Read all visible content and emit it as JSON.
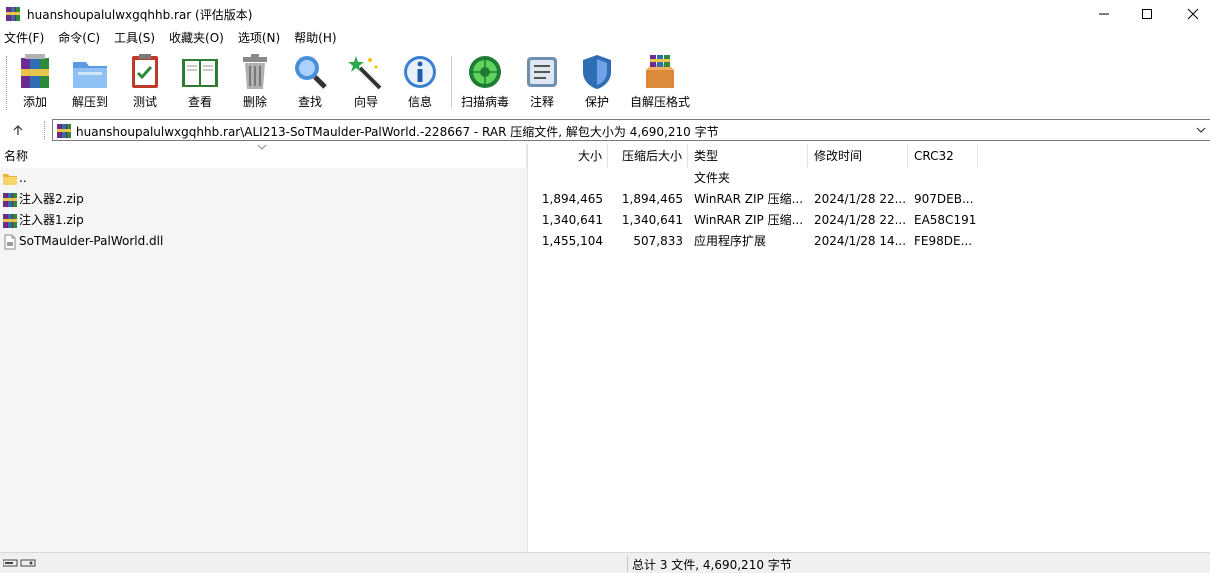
{
  "window": {
    "title": "huanshoupalulwxgqhhb.rar (评估版本)",
    "minimize_icon": "minimize-icon",
    "maximize_icon": "maximize-icon",
    "close_icon": "close-icon"
  },
  "menu": {
    "items": [
      "文件(F)",
      "命令(C)",
      "工具(S)",
      "收藏夹(O)",
      "选项(N)",
      "帮助(H)"
    ]
  },
  "toolbar": {
    "buttons": [
      {
        "label": "添加",
        "icon": "add-archive-icon"
      },
      {
        "label": "解压到",
        "icon": "extract-to-icon"
      },
      {
        "label": "测试",
        "icon": "test-icon"
      },
      {
        "label": "查看",
        "icon": "view-icon"
      },
      {
        "label": "删除",
        "icon": "delete-icon"
      },
      {
        "label": "查找",
        "icon": "find-icon"
      },
      {
        "label": "向导",
        "icon": "wizard-icon"
      },
      {
        "label": "信息",
        "icon": "info-icon"
      },
      {
        "label": "扫描病毒",
        "icon": "virus-scan-icon"
      },
      {
        "label": "注释",
        "icon": "comment-icon"
      },
      {
        "label": "保护",
        "icon": "protect-icon"
      },
      {
        "label": "自解压格式",
        "icon": "sfx-icon"
      }
    ]
  },
  "address": {
    "text": "huanshoupalulwxgqhhb.rar\\ALI213-SoTMaulder-PalWorld.-228667 - RAR 压缩文件, 解包大小为 4,690,210 字节"
  },
  "columns": {
    "name": "名称",
    "size": "大小",
    "packed": "压缩后大小",
    "type": "类型",
    "modified": "修改时间",
    "crc": "CRC32"
  },
  "files": [
    {
      "name": "..",
      "size": "",
      "packed": "",
      "type": "文件夹",
      "modified": "",
      "crc": "",
      "icon": "folder-icon"
    },
    {
      "name": "注入器2.zip",
      "size": "1,894,465",
      "packed": "1,894,465",
      "type": "WinRAR ZIP 压缩...",
      "modified": "2024/1/28 22...",
      "crc": "907DEB...",
      "icon": "zip-archive-icon"
    },
    {
      "name": "注入器1.zip",
      "size": "1,340,641",
      "packed": "1,340,641",
      "type": "WinRAR ZIP 压缩...",
      "modified": "2024/1/28 22...",
      "crc": "EA58C191",
      "icon": "zip-archive-icon"
    },
    {
      "name": "SoTMaulder-PalWorld.dll",
      "size": "1,455,104",
      "packed": "507,833",
      "type": "应用程序扩展",
      "modified": "2024/1/28 14...",
      "crc": "FE98DE...",
      "icon": "dll-file-icon"
    }
  ],
  "status": {
    "text": "总计 3 文件, 4,690,210 字节"
  }
}
